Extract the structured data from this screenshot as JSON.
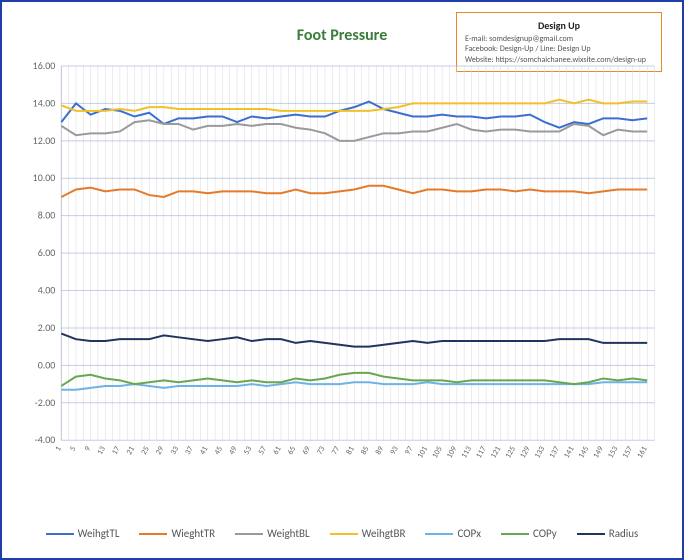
{
  "title": "Foot Pressure",
  "infobox": {
    "heading": "Design Up",
    "line1": "E-mail: somdesignup@gmail.com",
    "line2": "Facebook: Design-Up  /  Line: Design Up",
    "line3": "Website: https://somchaichanee.wixsite.com/design-up"
  },
  "legend": [
    {
      "name": "WeihgtTL",
      "color": "#3b6fcf"
    },
    {
      "name": "WieghtTR",
      "color": "#e47a2a"
    },
    {
      "name": "WeightBL",
      "color": "#9a9a9a"
    },
    {
      "name": "WeihgtBR",
      "color": "#f2c129"
    },
    {
      "name": "COPx",
      "color": "#6fb3e6"
    },
    {
      "name": "COPy",
      "color": "#66a84f"
    },
    {
      "name": "Radius",
      "color": "#1f355f"
    }
  ],
  "chart_data": {
    "type": "line",
    "title": "Foot Pressure",
    "xlabel": "",
    "ylabel": "",
    "ylim": [
      -4,
      16
    ],
    "yticks": [
      -4,
      -2,
      0,
      2,
      4,
      6,
      8,
      10,
      12,
      14,
      16
    ],
    "xticks": [
      1,
      5,
      9,
      13,
      17,
      21,
      25,
      29,
      33,
      37,
      41,
      45,
      49,
      53,
      57,
      61,
      65,
      69,
      73,
      77,
      81,
      85,
      89,
      93,
      97,
      101,
      105,
      109,
      113,
      117,
      121,
      125,
      129,
      133,
      137,
      141,
      145,
      149,
      153,
      157,
      161
    ],
    "xlim": [
      1,
      163
    ],
    "series": [
      {
        "name": "WeihgtTL",
        "color": "#3b6fcf",
        "values": [
          [
            1,
            13.0
          ],
          [
            5,
            14.0
          ],
          [
            9,
            13.4
          ],
          [
            13,
            13.7
          ],
          [
            17,
            13.6
          ],
          [
            21,
            13.3
          ],
          [
            25,
            13.5
          ],
          [
            29,
            12.9
          ],
          [
            33,
            13.2
          ],
          [
            37,
            13.2
          ],
          [
            41,
            13.3
          ],
          [
            45,
            13.3
          ],
          [
            49,
            13.0
          ],
          [
            53,
            13.3
          ],
          [
            57,
            13.2
          ],
          [
            61,
            13.3
          ],
          [
            65,
            13.4
          ],
          [
            69,
            13.3
          ],
          [
            73,
            13.3
          ],
          [
            77,
            13.6
          ],
          [
            81,
            13.8
          ],
          [
            85,
            14.1
          ],
          [
            89,
            13.7
          ],
          [
            93,
            13.5
          ],
          [
            97,
            13.3
          ],
          [
            101,
            13.3
          ],
          [
            105,
            13.4
          ],
          [
            109,
            13.3
          ],
          [
            113,
            13.3
          ],
          [
            117,
            13.2
          ],
          [
            121,
            13.3
          ],
          [
            125,
            13.3
          ],
          [
            129,
            13.4
          ],
          [
            133,
            13.0
          ],
          [
            137,
            12.7
          ],
          [
            141,
            13.0
          ],
          [
            145,
            12.9
          ],
          [
            149,
            13.2
          ],
          [
            153,
            13.2
          ],
          [
            157,
            13.1
          ],
          [
            161,
            13.2
          ]
        ]
      },
      {
        "name": "WieghtTR",
        "color": "#e47a2a",
        "values": [
          [
            1,
            9.0
          ],
          [
            5,
            9.4
          ],
          [
            9,
            9.5
          ],
          [
            13,
            9.3
          ],
          [
            17,
            9.4
          ],
          [
            21,
            9.4
          ],
          [
            25,
            9.1
          ],
          [
            29,
            9.0
          ],
          [
            33,
            9.3
          ],
          [
            37,
            9.3
          ],
          [
            41,
            9.2
          ],
          [
            45,
            9.3
          ],
          [
            49,
            9.3
          ],
          [
            53,
            9.3
          ],
          [
            57,
            9.2
          ],
          [
            61,
            9.2
          ],
          [
            65,
            9.4
          ],
          [
            69,
            9.2
          ],
          [
            73,
            9.2
          ],
          [
            77,
            9.3
          ],
          [
            81,
            9.4
          ],
          [
            85,
            9.6
          ],
          [
            89,
            9.6
          ],
          [
            93,
            9.4
          ],
          [
            97,
            9.2
          ],
          [
            101,
            9.4
          ],
          [
            105,
            9.4
          ],
          [
            109,
            9.3
          ],
          [
            113,
            9.3
          ],
          [
            117,
            9.4
          ],
          [
            121,
            9.4
          ],
          [
            125,
            9.3
          ],
          [
            129,
            9.4
          ],
          [
            133,
            9.3
          ],
          [
            137,
            9.3
          ],
          [
            141,
            9.3
          ],
          [
            145,
            9.2
          ],
          [
            149,
            9.3
          ],
          [
            153,
            9.4
          ],
          [
            157,
            9.4
          ],
          [
            161,
            9.4
          ]
        ]
      },
      {
        "name": "WeightBL",
        "color": "#9a9a9a",
        "values": [
          [
            1,
            12.8
          ],
          [
            5,
            12.3
          ],
          [
            9,
            12.4
          ],
          [
            13,
            12.4
          ],
          [
            17,
            12.5
          ],
          [
            21,
            13.0
          ],
          [
            25,
            13.1
          ],
          [
            29,
            12.9
          ],
          [
            33,
            12.9
          ],
          [
            37,
            12.6
          ],
          [
            41,
            12.8
          ],
          [
            45,
            12.8
          ],
          [
            49,
            12.9
          ],
          [
            53,
            12.8
          ],
          [
            57,
            12.9
          ],
          [
            61,
            12.9
          ],
          [
            65,
            12.7
          ],
          [
            69,
            12.6
          ],
          [
            73,
            12.4
          ],
          [
            77,
            12.0
          ],
          [
            81,
            12.0
          ],
          [
            85,
            12.2
          ],
          [
            89,
            12.4
          ],
          [
            93,
            12.4
          ],
          [
            97,
            12.5
          ],
          [
            101,
            12.5
          ],
          [
            105,
            12.7
          ],
          [
            109,
            12.9
          ],
          [
            113,
            12.6
          ],
          [
            117,
            12.5
          ],
          [
            121,
            12.6
          ],
          [
            125,
            12.6
          ],
          [
            129,
            12.5
          ],
          [
            133,
            12.5
          ],
          [
            137,
            12.5
          ],
          [
            141,
            12.9
          ],
          [
            145,
            12.8
          ],
          [
            149,
            12.3
          ],
          [
            153,
            12.6
          ],
          [
            157,
            12.5
          ],
          [
            161,
            12.5
          ]
        ]
      },
      {
        "name": "WeihgtBR",
        "color": "#f2c129",
        "values": [
          [
            1,
            13.9
          ],
          [
            5,
            13.6
          ],
          [
            9,
            13.6
          ],
          [
            13,
            13.6
          ],
          [
            17,
            13.7
          ],
          [
            21,
            13.6
          ],
          [
            25,
            13.8
          ],
          [
            29,
            13.8
          ],
          [
            33,
            13.7
          ],
          [
            37,
            13.7
          ],
          [
            41,
            13.7
          ],
          [
            45,
            13.7
          ],
          [
            49,
            13.7
          ],
          [
            53,
            13.7
          ],
          [
            57,
            13.7
          ],
          [
            61,
            13.6
          ],
          [
            65,
            13.6
          ],
          [
            69,
            13.6
          ],
          [
            73,
            13.6
          ],
          [
            77,
            13.6
          ],
          [
            81,
            13.6
          ],
          [
            85,
            13.6
          ],
          [
            89,
            13.7
          ],
          [
            93,
            13.8
          ],
          [
            97,
            14.0
          ],
          [
            101,
            14.0
          ],
          [
            105,
            14.0
          ],
          [
            109,
            14.0
          ],
          [
            113,
            14.0
          ],
          [
            117,
            14.0
          ],
          [
            121,
            14.0
          ],
          [
            125,
            14.0
          ],
          [
            129,
            14.0
          ],
          [
            133,
            14.0
          ],
          [
            137,
            14.2
          ],
          [
            141,
            14.0
          ],
          [
            145,
            14.2
          ],
          [
            149,
            14.0
          ],
          [
            153,
            14.0
          ],
          [
            157,
            14.1
          ],
          [
            161,
            14.1
          ]
        ]
      },
      {
        "name": "COPx",
        "color": "#6fb3e6",
        "values": [
          [
            1,
            -1.3
          ],
          [
            5,
            -1.3
          ],
          [
            9,
            -1.2
          ],
          [
            13,
            -1.1
          ],
          [
            17,
            -1.1
          ],
          [
            21,
            -1.0
          ],
          [
            25,
            -1.1
          ],
          [
            29,
            -1.2
          ],
          [
            33,
            -1.1
          ],
          [
            37,
            -1.1
          ],
          [
            41,
            -1.1
          ],
          [
            45,
            -1.1
          ],
          [
            49,
            -1.1
          ],
          [
            53,
            -1.0
          ],
          [
            57,
            -1.1
          ],
          [
            61,
            -1.0
          ],
          [
            65,
            -0.9
          ],
          [
            69,
            -1.0
          ],
          [
            73,
            -1.0
          ],
          [
            77,
            -1.0
          ],
          [
            81,
            -0.9
          ],
          [
            85,
            -0.9
          ],
          [
            89,
            -1.0
          ],
          [
            93,
            -1.0
          ],
          [
            97,
            -1.0
          ],
          [
            101,
            -0.9
          ],
          [
            105,
            -1.0
          ],
          [
            109,
            -1.0
          ],
          [
            113,
            -1.0
          ],
          [
            117,
            -1.0
          ],
          [
            121,
            -1.0
          ],
          [
            125,
            -1.0
          ],
          [
            129,
            -1.0
          ],
          [
            133,
            -1.0
          ],
          [
            137,
            -1.0
          ],
          [
            141,
            -1.0
          ],
          [
            145,
            -1.0
          ],
          [
            149,
            -0.9
          ],
          [
            153,
            -0.9
          ],
          [
            157,
            -0.9
          ],
          [
            161,
            -0.9
          ]
        ]
      },
      {
        "name": "COPy",
        "color": "#66a84f",
        "values": [
          [
            1,
            -1.1
          ],
          [
            5,
            -0.6
          ],
          [
            9,
            -0.5
          ],
          [
            13,
            -0.7
          ],
          [
            17,
            -0.8
          ],
          [
            21,
            -1.0
          ],
          [
            25,
            -0.9
          ],
          [
            29,
            -0.8
          ],
          [
            33,
            -0.9
          ],
          [
            37,
            -0.8
          ],
          [
            41,
            -0.7
          ],
          [
            45,
            -0.8
          ],
          [
            49,
            -0.9
          ],
          [
            53,
            -0.8
          ],
          [
            57,
            -0.9
          ],
          [
            61,
            -0.9
          ],
          [
            65,
            -0.7
          ],
          [
            69,
            -0.8
          ],
          [
            73,
            -0.7
          ],
          [
            77,
            -0.5
          ],
          [
            81,
            -0.4
          ],
          [
            85,
            -0.4
          ],
          [
            89,
            -0.6
          ],
          [
            93,
            -0.7
          ],
          [
            97,
            -0.8
          ],
          [
            101,
            -0.8
          ],
          [
            105,
            -0.8
          ],
          [
            109,
            -0.9
          ],
          [
            113,
            -0.8
          ],
          [
            117,
            -0.8
          ],
          [
            121,
            -0.8
          ],
          [
            125,
            -0.8
          ],
          [
            129,
            -0.8
          ],
          [
            133,
            -0.8
          ],
          [
            137,
            -0.9
          ],
          [
            141,
            -1.0
          ],
          [
            145,
            -0.9
          ],
          [
            149,
            -0.7
          ],
          [
            153,
            -0.8
          ],
          [
            157,
            -0.7
          ],
          [
            161,
            -0.8
          ]
        ]
      },
      {
        "name": "Radius",
        "color": "#1f355f",
        "values": [
          [
            1,
            1.7
          ],
          [
            5,
            1.4
          ],
          [
            9,
            1.3
          ],
          [
            13,
            1.3
          ],
          [
            17,
            1.4
          ],
          [
            21,
            1.4
          ],
          [
            25,
            1.4
          ],
          [
            29,
            1.6
          ],
          [
            33,
            1.5
          ],
          [
            37,
            1.4
          ],
          [
            41,
            1.3
          ],
          [
            45,
            1.4
          ],
          [
            49,
            1.5
          ],
          [
            53,
            1.3
          ],
          [
            57,
            1.4
          ],
          [
            61,
            1.4
          ],
          [
            65,
            1.2
          ],
          [
            69,
            1.3
          ],
          [
            73,
            1.2
          ],
          [
            77,
            1.1
          ],
          [
            81,
            1.0
          ],
          [
            85,
            1.0
          ],
          [
            89,
            1.1
          ],
          [
            93,
            1.2
          ],
          [
            97,
            1.3
          ],
          [
            101,
            1.2
          ],
          [
            105,
            1.3
          ],
          [
            109,
            1.3
          ],
          [
            113,
            1.3
          ],
          [
            117,
            1.3
          ],
          [
            121,
            1.3
          ],
          [
            125,
            1.3
          ],
          [
            129,
            1.3
          ],
          [
            133,
            1.3
          ],
          [
            137,
            1.4
          ],
          [
            141,
            1.4
          ],
          [
            145,
            1.4
          ],
          [
            149,
            1.2
          ],
          [
            153,
            1.2
          ],
          [
            157,
            1.2
          ],
          [
            161,
            1.2
          ]
        ]
      }
    ]
  }
}
